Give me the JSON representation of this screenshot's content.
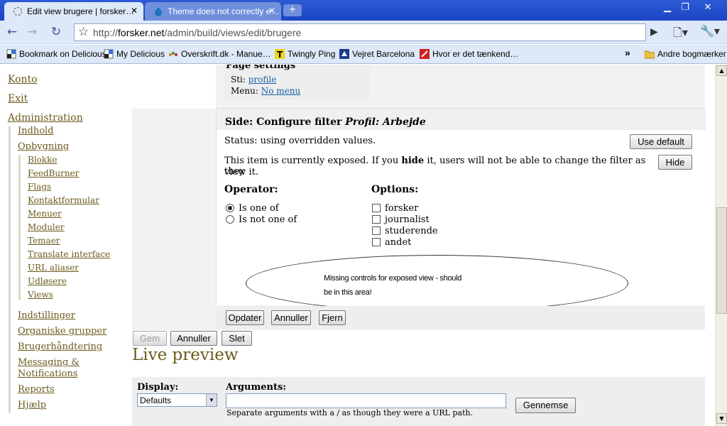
{
  "tabs": [
    {
      "title": "Edit view brugere | forsker…",
      "active": true
    },
    {
      "title": "Theme does not correctly e…",
      "active": false
    }
  ],
  "window_controls": {
    "minimize": "▁",
    "restore": "❐",
    "close": "✕"
  },
  "toolbar": {
    "url_scheme": "http://",
    "url_host": "forsker.net",
    "url_path": "/admin/build/views/edit/brugere"
  },
  "bookmarks": [
    {
      "label": "Bookmark on Delicious",
      "icon": "delicious-icon"
    },
    {
      "label": "My Delicious",
      "icon": "delicious-icon"
    },
    {
      "label": "Overskrift.dk - Manue…",
      "icon": "overskrift-icon"
    },
    {
      "label": "Twingly Ping",
      "icon": "twingly-icon"
    },
    {
      "label": "Vejret Barcelona",
      "icon": "weather-icon"
    },
    {
      "label": "Hvor er det tænkend…",
      "icon": "page-icon"
    }
  ],
  "other_bookmarks": "Andre bogmærker",
  "sidebar": {
    "top": [
      {
        "label": "Konto"
      },
      {
        "label": "Exit"
      },
      {
        "label": "Administration"
      }
    ],
    "admin": [
      {
        "label": "Indhold"
      },
      {
        "label": "Opbygning"
      }
    ],
    "opbygning": [
      {
        "label": "Blokke"
      },
      {
        "label": "FeedBurner"
      },
      {
        "label": "Flags"
      },
      {
        "label": "Kontaktformular"
      },
      {
        "label": "Menuer"
      },
      {
        "label": "Moduler"
      },
      {
        "label": "Temaer"
      },
      {
        "label": "Translate interface"
      },
      {
        "label": "URL aliaser"
      },
      {
        "label": "Udløsere"
      },
      {
        "label": "Views"
      }
    ],
    "admin_rest": [
      {
        "label": "Indstillinger"
      },
      {
        "label": "Organiske grupper"
      },
      {
        "label": "Brugerhåndtering"
      },
      {
        "label": "Messaging &"
      },
      {
        "label": "Notifications"
      },
      {
        "label": "Reports"
      },
      {
        "label": "Hjælp"
      }
    ]
  },
  "page_settings": {
    "title": "Page settings",
    "path_label": "Sti:",
    "path_value": "profile",
    "menu_label": "Menu:",
    "menu_value": "No menu"
  },
  "filter": {
    "title_prefix": "Side: Configure filter",
    "title_em": "Profil: Arbejde",
    "status": "Status: using overridden values.",
    "use_default": "Use default",
    "exposed_pre": "This item is currently exposed. If you",
    "exposed_bold": "hide",
    "exposed_post": "it, users will not be able to change the filter as they",
    "exposed_line2": "view it.",
    "hide": "Hide",
    "operator_label": "Operator:",
    "operators": [
      {
        "label": "Is one of",
        "checked": true
      },
      {
        "label": "Is not one of",
        "checked": false
      }
    ],
    "options_label": "Options:",
    "options": [
      {
        "label": "forsker"
      },
      {
        "label": "journalist"
      },
      {
        "label": "studerende"
      },
      {
        "label": "andet"
      }
    ]
  },
  "annotation": {
    "line1": "Missing controls for exposed view - should",
    "line2": "be in this area!"
  },
  "filter_actions": {
    "update": "Opdater",
    "cancel": "Annuller",
    "remove": "Fjern"
  },
  "view_actions": {
    "save": "Gem",
    "cancel": "Annuller",
    "delete": "Slet"
  },
  "live_preview": {
    "title": "Live preview",
    "display_label": "Display:",
    "display_value": "Defaults",
    "arguments_label": "Arguments:",
    "arguments_value": "",
    "arguments_help": "Separate arguments with a / as though they were a URL path.",
    "submit": "Gennemse"
  }
}
